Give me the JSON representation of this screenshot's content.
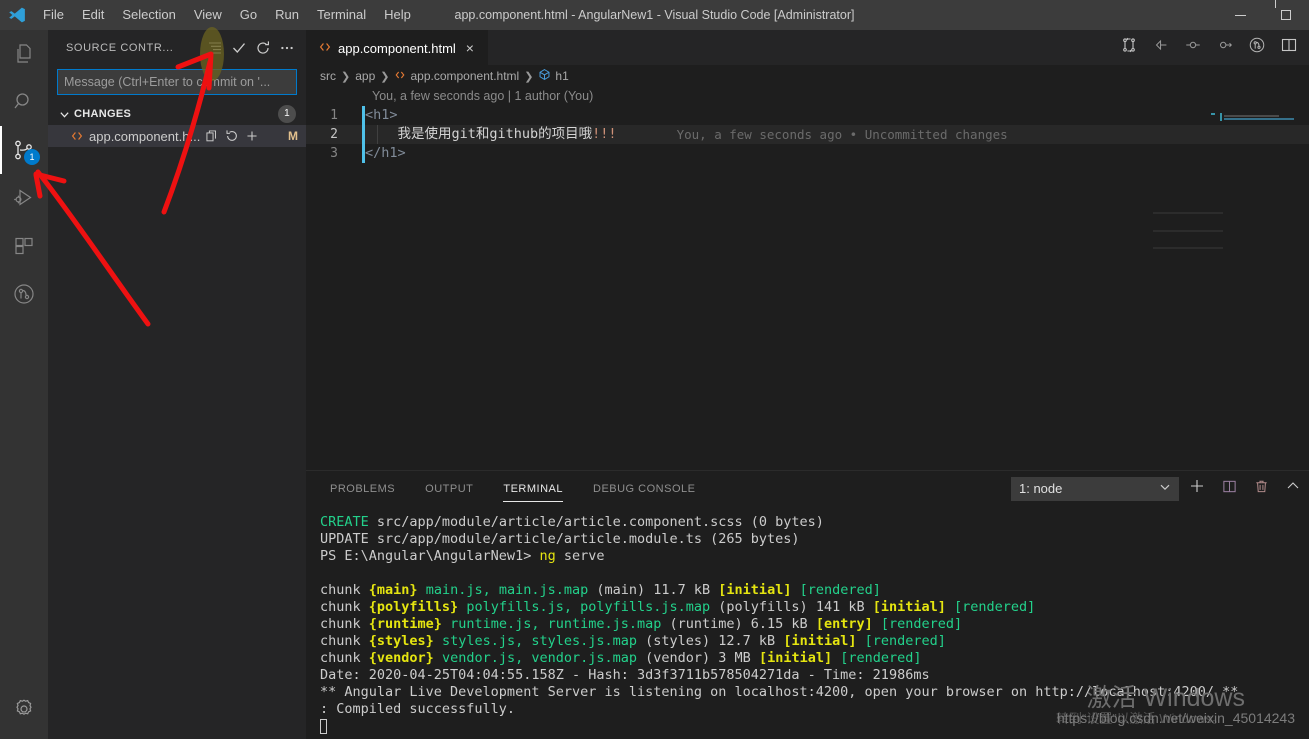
{
  "titlebar": {
    "logo_icon": "vscode-logo-icon",
    "menus": [
      "File",
      "Edit",
      "Selection",
      "View",
      "Go",
      "Run",
      "Terminal",
      "Help"
    ],
    "title": "app.component.html - AngularNew1 - Visual Studio Code [Administrator]",
    "window_controls": [
      "minimize-icon",
      "maximize-icon"
    ]
  },
  "activitybar": {
    "items": [
      {
        "name": "explorer",
        "icon": "files-icon",
        "badge": ""
      },
      {
        "name": "search",
        "icon": "search-icon",
        "badge": ""
      },
      {
        "name": "source-control",
        "icon": "source-control-icon",
        "badge": "1"
      },
      {
        "name": "run-and-debug",
        "icon": "run-debug-icon",
        "badge": ""
      },
      {
        "name": "extensions",
        "icon": "extensions-icon",
        "badge": ""
      },
      {
        "name": "gitlens",
        "icon": "gitlens-icon",
        "badge": ""
      }
    ],
    "settings": {
      "name": "manage",
      "icon": "gear-icon"
    }
  },
  "sidebar": {
    "title": "SOURCE CONTR...",
    "actions": [
      {
        "name": "view-as-list",
        "icon": "list-icon"
      },
      {
        "name": "commit",
        "icon": "check-icon"
      },
      {
        "name": "refresh",
        "icon": "refresh-icon"
      },
      {
        "name": "more-actions",
        "icon": "ellipsis-icon"
      }
    ],
    "commit_input": {
      "value": "",
      "placeholder": "Message (Ctrl+Enter to commit on '..."
    },
    "changes": {
      "label": "CHANGES",
      "count": "1",
      "files": [
        {
          "name": "app.component.h...",
          "icon": "html-file-icon",
          "status": "M",
          "actions": [
            "open-file-icon",
            "discard-changes-icon",
            "stage-changes-icon"
          ]
        }
      ]
    }
  },
  "editor": {
    "tab": {
      "label": "app.component.html",
      "icon": "html-file-icon",
      "close": "×"
    },
    "toolbar": [
      {
        "name": "open-changes",
        "icon": "compare-changes-icon"
      },
      {
        "name": "previous-change",
        "icon": "arrow-left-circle-icon"
      },
      {
        "name": "toggle-change",
        "icon": "dot-circle-icon"
      },
      {
        "name": "next-change",
        "icon": "arrow-right-circle-icon"
      },
      {
        "name": "gitlens-blame",
        "icon": "gitlens-icon"
      },
      {
        "name": "split-editor",
        "icon": "split-editor-icon"
      }
    ],
    "breadcrumbs": [
      {
        "label": "src",
        "icon": ""
      },
      {
        "label": "app",
        "icon": ""
      },
      {
        "label": "app.component.html",
        "icon": "html-file-icon"
      },
      {
        "label": "h1",
        "icon": "symbol-field-icon"
      }
    ],
    "blame_header": "You, a few seconds ago | 1 author (You)",
    "lines": [
      {
        "no": "1",
        "tokens": [
          {
            "t": "tag",
            "v": "<h1>"
          }
        ],
        "changed": true,
        "current": false,
        "inline_blame": ""
      },
      {
        "no": "2",
        "tokens": [
          {
            "t": "text",
            "v": "    我是使用git和github的项目哦"
          },
          {
            "t": "bang",
            "v": "!!!"
          }
        ],
        "changed": true,
        "current": true,
        "inline_blame": "You, a few seconds ago • Uncommitted changes"
      },
      {
        "no": "3",
        "tokens": [
          {
            "t": "tag",
            "v": "</h1>"
          }
        ],
        "changed": true,
        "current": false,
        "inline_blame": ""
      }
    ]
  },
  "panel": {
    "tabs": [
      {
        "label": "PROBLEMS",
        "active": false
      },
      {
        "label": "OUTPUT",
        "active": false
      },
      {
        "label": "TERMINAL",
        "active": true
      },
      {
        "label": "DEBUG CONSOLE",
        "active": false
      }
    ],
    "terminal_select": {
      "value": "1: node",
      "chevron": "chevron-down-icon"
    },
    "buttons": [
      {
        "name": "new-terminal",
        "icon": "plus-icon"
      },
      {
        "name": "split-terminal",
        "icon": "split-icon"
      },
      {
        "name": "kill-terminal",
        "icon": "trash-icon"
      },
      {
        "name": "maximize-panel",
        "icon": "chevron-up-icon"
      }
    ],
    "terminal_lines": [
      [
        {
          "c": "green",
          "v": "CREATE"
        },
        {
          "c": "grey",
          "v": " src/app/module/article/article.component.scss (0 bytes)"
        }
      ],
      [
        {
          "c": "grey",
          "v": "UPDATE src/app/module/article/article.module.ts (265 bytes)"
        }
      ],
      [
        {
          "c": "grey",
          "v": "PS E:\\Angular\\AngularNew1> "
        },
        {
          "c": "yellow",
          "v": "ng"
        },
        {
          "c": "grey",
          "v": " serve"
        }
      ],
      [
        {
          "c": "grey",
          "v": ""
        }
      ],
      [
        {
          "c": "grey",
          "v": "chunk "
        },
        {
          "c": "yellow bold",
          "v": "{main}"
        },
        {
          "c": "green",
          "v": " main.js, main.js.map"
        },
        {
          "c": "grey",
          "v": " (main) 11.7 kB "
        },
        {
          "c": "yellow bold",
          "v": "[initial]"
        },
        {
          "c": "green",
          "v": " [rendered]"
        }
      ],
      [
        {
          "c": "grey",
          "v": "chunk "
        },
        {
          "c": "yellow bold",
          "v": "{polyfills}"
        },
        {
          "c": "green",
          "v": " polyfills.js, polyfills.js.map"
        },
        {
          "c": "grey",
          "v": " (polyfills) 141 kB "
        },
        {
          "c": "yellow bold",
          "v": "[initial]"
        },
        {
          "c": "green",
          "v": " [rendered]"
        }
      ],
      [
        {
          "c": "grey",
          "v": "chunk "
        },
        {
          "c": "yellow bold",
          "v": "{runtime}"
        },
        {
          "c": "green",
          "v": " runtime.js, runtime.js.map"
        },
        {
          "c": "grey",
          "v": " (runtime) 6.15 kB "
        },
        {
          "c": "yellow bold",
          "v": "[entry]"
        },
        {
          "c": "green",
          "v": " [rendered]"
        }
      ],
      [
        {
          "c": "grey",
          "v": "chunk "
        },
        {
          "c": "yellow bold",
          "v": "{styles}"
        },
        {
          "c": "green",
          "v": " styles.js, styles.js.map"
        },
        {
          "c": "grey",
          "v": " (styles) 12.7 kB "
        },
        {
          "c": "yellow bold",
          "v": "[initial]"
        },
        {
          "c": "green",
          "v": " [rendered]"
        }
      ],
      [
        {
          "c": "grey",
          "v": "chunk "
        },
        {
          "c": "yellow bold",
          "v": "{vendor}"
        },
        {
          "c": "green",
          "v": " vendor.js, vendor.js.map"
        },
        {
          "c": "grey",
          "v": " (vendor) 3 MB "
        },
        {
          "c": "yellow bold",
          "v": "[initial]"
        },
        {
          "c": "green",
          "v": " [rendered]"
        }
      ],
      [
        {
          "c": "grey",
          "v": "Date: 2020-04-25T04:04:55.158Z - Hash: 3d3f3711b578504271da - Time: 21986ms"
        }
      ],
      [
        {
          "c": "grey",
          "v": "** Angular Live Development Server is listening on localhost:4200, open your browser on http://localhost:4200/ **"
        }
      ],
      [
        {
          "c": "grey",
          "v": ": Compiled successfully."
        }
      ]
    ]
  },
  "watermarks": {
    "activate_windows": "激活 Windows",
    "activate_sub": "转到“设置”以激活 Windows。",
    "blog_url": "https://blog.csdn.net/weixin_45014243"
  },
  "annotations": {
    "arrow_color": "#ee1111",
    "highlight_color": "#6b6320",
    "arrows": [
      {
        "name": "arrow-to-commit-button"
      },
      {
        "name": "arrow-to-source-control-badge"
      }
    ]
  }
}
